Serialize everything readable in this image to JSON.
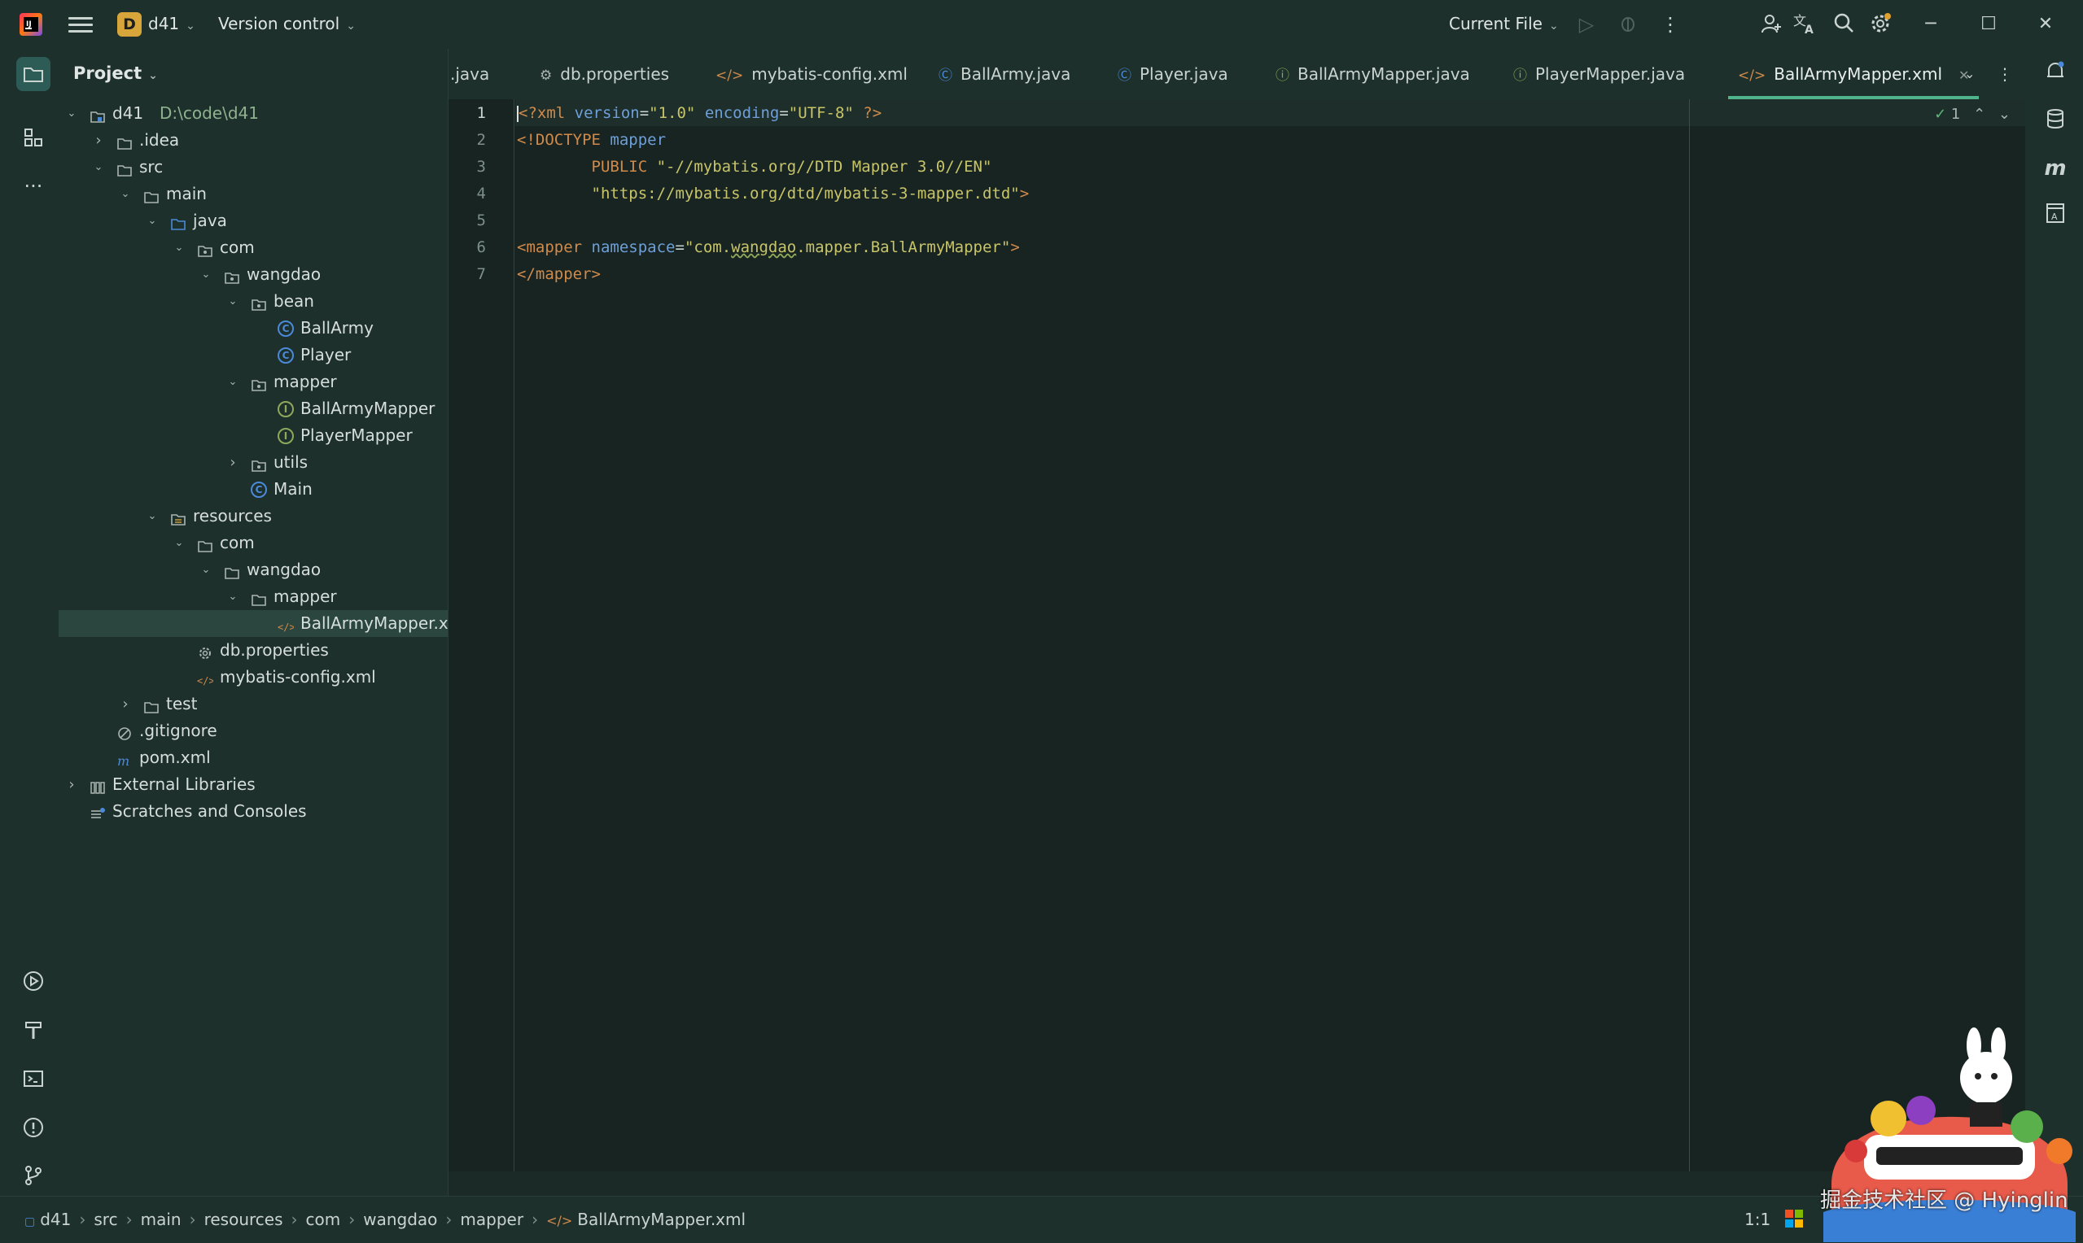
{
  "titlebar": {
    "project_badge": "D",
    "project_name": "d41",
    "vcs_label": "Version control",
    "run_config": "Current File"
  },
  "project_panel": {
    "header": "Project",
    "tree": [
      {
        "label": "d41",
        "path": "D:\\code\\d41",
        "depth": 0,
        "icon": "module-folder-icon",
        "expanded": true
      },
      {
        "label": ".idea",
        "depth": 1,
        "icon": "folder-icon",
        "expanded": false
      },
      {
        "label": "src",
        "depth": 1,
        "icon": "folder-icon",
        "expanded": true
      },
      {
        "label": "main",
        "depth": 2,
        "icon": "folder-icon",
        "expanded": true
      },
      {
        "label": "java",
        "depth": 3,
        "icon": "source-folder-icon",
        "expanded": true
      },
      {
        "label": "com",
        "depth": 4,
        "icon": "package-icon",
        "expanded": true
      },
      {
        "label": "wangdao",
        "depth": 5,
        "icon": "package-icon",
        "expanded": true
      },
      {
        "label": "bean",
        "depth": 6,
        "icon": "package-icon",
        "expanded": true
      },
      {
        "label": "BallArmy",
        "depth": 7,
        "icon": "class-icon"
      },
      {
        "label": "Player",
        "depth": 7,
        "icon": "class-icon"
      },
      {
        "label": "mapper",
        "depth": 6,
        "icon": "package-icon",
        "expanded": true
      },
      {
        "label": "BallArmyMapper",
        "depth": 7,
        "icon": "interface-icon"
      },
      {
        "label": "PlayerMapper",
        "depth": 7,
        "icon": "interface-icon"
      },
      {
        "label": "utils",
        "depth": 6,
        "icon": "package-icon",
        "expanded": false
      },
      {
        "label": "Main",
        "depth": 6,
        "icon": "class-icon"
      },
      {
        "label": "resources",
        "depth": 3,
        "icon": "resources-folder-icon",
        "expanded": true
      },
      {
        "label": "com",
        "depth": 4,
        "icon": "folder-icon",
        "expanded": true
      },
      {
        "label": "wangdao",
        "depth": 5,
        "icon": "folder-icon",
        "expanded": true
      },
      {
        "label": "mapper",
        "depth": 6,
        "icon": "folder-icon",
        "expanded": true
      },
      {
        "label": "BallArmyMapper.xml",
        "depth": 7,
        "icon": "xml-file-icon",
        "selected": true
      },
      {
        "label": "db.properties",
        "depth": 4,
        "icon": "properties-file-icon"
      },
      {
        "label": "mybatis-config.xml",
        "depth": 4,
        "icon": "xml-file-icon"
      },
      {
        "label": "test",
        "depth": 2,
        "icon": "folder-icon",
        "expanded": false
      },
      {
        "label": ".gitignore",
        "depth": 1,
        "icon": "ignore-file-icon"
      },
      {
        "label": "pom.xml",
        "depth": 1,
        "icon": "maven-file-icon"
      },
      {
        "label": "External Libraries",
        "depth": 0,
        "icon": "library-icon",
        "expanded": false
      },
      {
        "label": "Scratches and Consoles",
        "depth": 0,
        "icon": "scratches-icon"
      }
    ]
  },
  "tabs": [
    {
      "label": ".java",
      "icon": "none"
    },
    {
      "label": "db.properties",
      "icon": "gear"
    },
    {
      "label": "mybatis-config.xml",
      "icon": "xml"
    },
    {
      "label": "BallArmy.java",
      "icon": "class"
    },
    {
      "label": "Player.java",
      "icon": "class"
    },
    {
      "label": "BallArmyMapper.java",
      "icon": "interface"
    },
    {
      "label": "PlayerMapper.java",
      "icon": "interface"
    },
    {
      "label": "BallArmyMapper.xml",
      "icon": "xml",
      "active": true
    }
  ],
  "editor": {
    "line_numbers": [
      "1",
      "2",
      "3",
      "4",
      "5",
      "6",
      "7"
    ],
    "inspection_count": "1",
    "code": {
      "l1_a": "<?xml ",
      "l1_b": "version",
      "l1_c": "=",
      "l1_d": "\"1.0\"",
      "l1_e": " encoding",
      "l1_f": "=",
      "l1_g": "\"UTF-8\"",
      "l1_h": " ?>",
      "l2_a": "<!DOCTYPE ",
      "l2_b": "mapper",
      "l3_a": "        PUBLIC ",
      "l3_b": "\"-//mybatis.org//DTD Mapper 3.0//EN\"",
      "l4_a": "        ",
      "l4_b": "\"https://mybatis.org/dtd/mybatis-3-mapper.dtd\"",
      "l4_c": ">",
      "l6_a": "<",
      "l6_b": "mapper",
      "l6_c": " namespace",
      "l6_d": "=",
      "l6_e": "\"com.",
      "l6_f": "wangdao",
      "l6_g": ".mapper.BallArmyMapper\"",
      "l6_h": ">",
      "l7_a": "</",
      "l7_b": "mapper",
      "l7_c": ">"
    }
  },
  "statusbar": {
    "breadcrumb": [
      "d41",
      "src",
      "main",
      "resources",
      "com",
      "wangdao",
      "mapper",
      "BallArmyMapper.xml"
    ],
    "position": "1:1"
  },
  "watermark": "掘金技术社区 @ Hyinglin",
  "colors": {
    "background": "#1b2a27",
    "accent": "#4fb48c",
    "xml_tag": "#d08a4a",
    "attribute": "#6e9fd8",
    "string": "#c8c46a"
  }
}
